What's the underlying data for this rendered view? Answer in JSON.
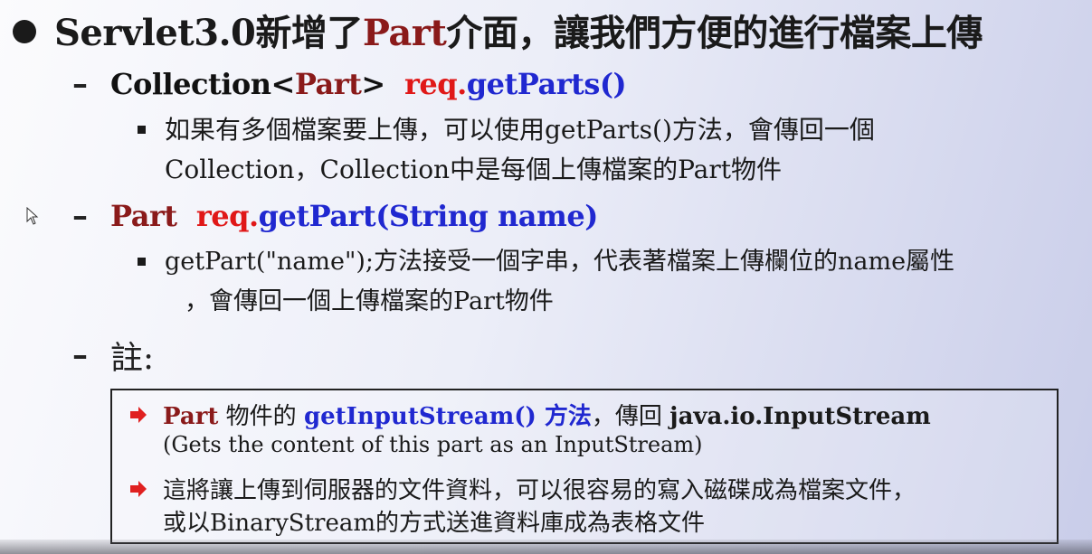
{
  "heading": {
    "prefix": "Servlet3.0新增了",
    "keyword": "Part",
    "suffix": "介面，讓我們方便的進行檔案上傳"
  },
  "item1": {
    "dash": "–",
    "type_prefix": "Collection<",
    "type_part": "Part",
    "type_suffix": ">",
    "obj": "req.",
    "method": "getParts()",
    "desc_line1": "如果有多個檔案要上傳，可以使用getParts()方法，會傳回一個",
    "desc_line2": "Collection，Collection中是每個上傳檔案的Part物件"
  },
  "item2": {
    "dash": "–",
    "type": "Part",
    "obj": "req.",
    "method": "getPart",
    "params": "(String name)",
    "desc_line1": "getPart(\"name\");方法接受一個字串，代表著檔案上傳欄位的name屬性",
    "desc_line2": "，會傳回一個上傳檔案的Part物件"
  },
  "item3": {
    "dash": "–",
    "label": "註:"
  },
  "note": {
    "line1_part": "Part",
    "line1_mid": " 物件的 ",
    "line1_method": "getInputStream() 方法",
    "line1_rest": "，傳回 ",
    "line1_pkg": "java.io.",
    "line1_class": "InputStream",
    "line2": "(Gets the content of this part as an InputStream)",
    "line3": "這將讓上傳到伺服器的文件資料，可以很容易的寫入磁碟成為檔案文件，",
    "line4": "或以BinaryStream的方式送進資料庫成為表格文件"
  },
  "colors": {
    "red": "#e01818",
    "dark_red": "#8a1a1a",
    "blue": "#2028d0",
    "arrow_red": "#e02020"
  },
  "icons": [
    "bullet-dot-icon",
    "square-bullet-icon",
    "arrow-bullet-icon",
    "mouse-cursor-icon"
  ]
}
